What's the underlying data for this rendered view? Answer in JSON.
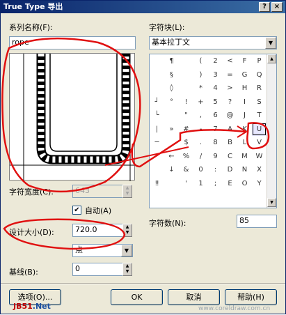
{
  "window": {
    "title": "True Type 导出"
  },
  "family": {
    "label": "系列名称(F):",
    "value": "rope"
  },
  "charblock": {
    "label": "字符块(L):",
    "value": "基本拉丁文"
  },
  "char_width": {
    "label": "字符宽度(C):",
    "value": "643"
  },
  "auto": {
    "label": "自动(A)",
    "checked": "✔"
  },
  "design_size": {
    "label": "设计大小(D):",
    "value": "720.0"
  },
  "unit": {
    "value": "点"
  },
  "baseline": {
    "label": "基线(B):",
    "value": "0"
  },
  "char_count": {
    "label": "字符数(N):",
    "value": "85"
  },
  "buttons": {
    "options": "选项(O)...",
    "ok": "OK",
    "cancel": "取消",
    "help": "帮助(H)"
  },
  "watermarks": {
    "left_prefix": "JB51",
    "left_suffix": ".Net",
    "right": "www.coreldraw.com.cn"
  },
  "glyph_grid": [
    " ",
    "¶",
    " ",
    "(",
    "2",
    "<",
    "F",
    "P",
    " ",
    "§",
    " ",
    ")",
    "3",
    "=",
    "G",
    "Q",
    " ",
    "◊",
    " ",
    "*",
    "4",
    ">",
    "H",
    "R",
    "┘",
    "°",
    "!",
    "+",
    "5",
    "?",
    "I",
    "S",
    "└",
    "",
    "\"",
    ",",
    "6",
    "@",
    "J",
    "T",
    "|",
    "»",
    "#",
    "-",
    "7",
    "A",
    "K",
    "U",
    "─",
    "",
    "$",
    ".",
    "8",
    "B",
    "L",
    "V",
    "",
    "←",
    "%",
    "/",
    "9",
    "C",
    "M",
    "W",
    "",
    "↓",
    "&",
    "0",
    ":",
    "D",
    "N",
    "X",
    "‼",
    "",
    "'",
    "1",
    ";",
    "E",
    "O",
    "Y",
    "",
    "",
    "",
    "",
    "",
    "",
    "",
    ""
  ],
  "icons": {
    "titlebar_help": "question-icon",
    "titlebar_close": "close-icon",
    "dropdown": "chevron-down-icon"
  }
}
